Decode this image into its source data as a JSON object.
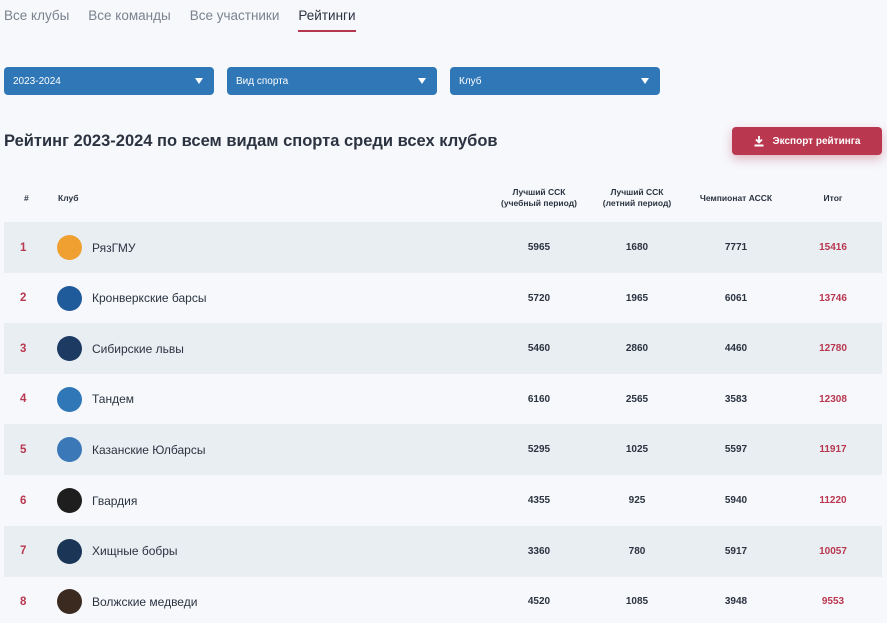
{
  "tabs": [
    "Все клубы",
    "Все команды",
    "Все участники",
    "Рейтинги"
  ],
  "active_tab": "Рейтинги",
  "filters": {
    "season": "2023-2024",
    "sport": "Вид спорта",
    "club": "Клуб"
  },
  "page_title": "Рейтинг 2023-2024 по всем видам спорта среди всех клубов",
  "export_label": "Экспорт рейтинга",
  "table": {
    "headers": {
      "rank": "#",
      "club": "Клуб",
      "ssk_study_1": "Лучший ССК",
      "ssk_study_2": "(учебный период)",
      "ssk_summer_1": "Лучший ССК",
      "ssk_summer_2": "(летний период)",
      "assk": "Чемпионат АССК",
      "total": "Итог"
    },
    "rows": [
      {
        "rank": "1",
        "club": "РязГМУ",
        "ssk_study": "5965",
        "ssk_summer": "1680",
        "assk": "7771",
        "total": "15416",
        "logo_color": "#f0a030",
        "logo_icon": "basketball-fire-icon"
      },
      {
        "rank": "2",
        "club": "Кронверкские барсы",
        "ssk_study": "5720",
        "ssk_summer": "1965",
        "assk": "6061",
        "total": "13746",
        "logo_color": "#1f5a9a",
        "logo_icon": "shield-icon"
      },
      {
        "rank": "3",
        "club": "Сибирские львы",
        "ssk_study": "5460",
        "ssk_summer": "2860",
        "assk": "4460",
        "total": "12780",
        "logo_color": "#1d3a63",
        "logo_icon": "lion-icon"
      },
      {
        "rank": "4",
        "club": "Тандем",
        "ssk_study": "6160",
        "ssk_summer": "2565",
        "assk": "3583",
        "total": "12308",
        "logo_color": "#2f77b7",
        "logo_icon": "tandem-icon"
      },
      {
        "rank": "5",
        "club": "Казанские Юлбарсы",
        "ssk_study": "5295",
        "ssk_summer": "1025",
        "assk": "5597",
        "total": "11917",
        "logo_color": "#3b78b8",
        "logo_icon": "tiger-shield-icon"
      },
      {
        "rank": "6",
        "club": "Гвардия",
        "ssk_study": "4355",
        "ssk_summer": "925",
        "assk": "5940",
        "total": "11220",
        "logo_color": "#1e1e1e",
        "logo_icon": "star-icon"
      },
      {
        "rank": "7",
        "club": "Хищные бобры",
        "ssk_study": "3360",
        "ssk_summer": "780",
        "assk": "5917",
        "total": "10057",
        "logo_color": "#1b3556",
        "logo_icon": "beaver-icon"
      },
      {
        "rank": "8",
        "club": "Волжские медведи",
        "ssk_study": "4520",
        "ssk_summer": "1085",
        "assk": "3948",
        "total": "9553",
        "logo_color": "#3a2a20",
        "logo_icon": "bear-icon"
      }
    ]
  },
  "colors": {
    "accent": "#b9374f",
    "select_bg": "#2f77b7",
    "row_shade": "#e8eef2"
  }
}
